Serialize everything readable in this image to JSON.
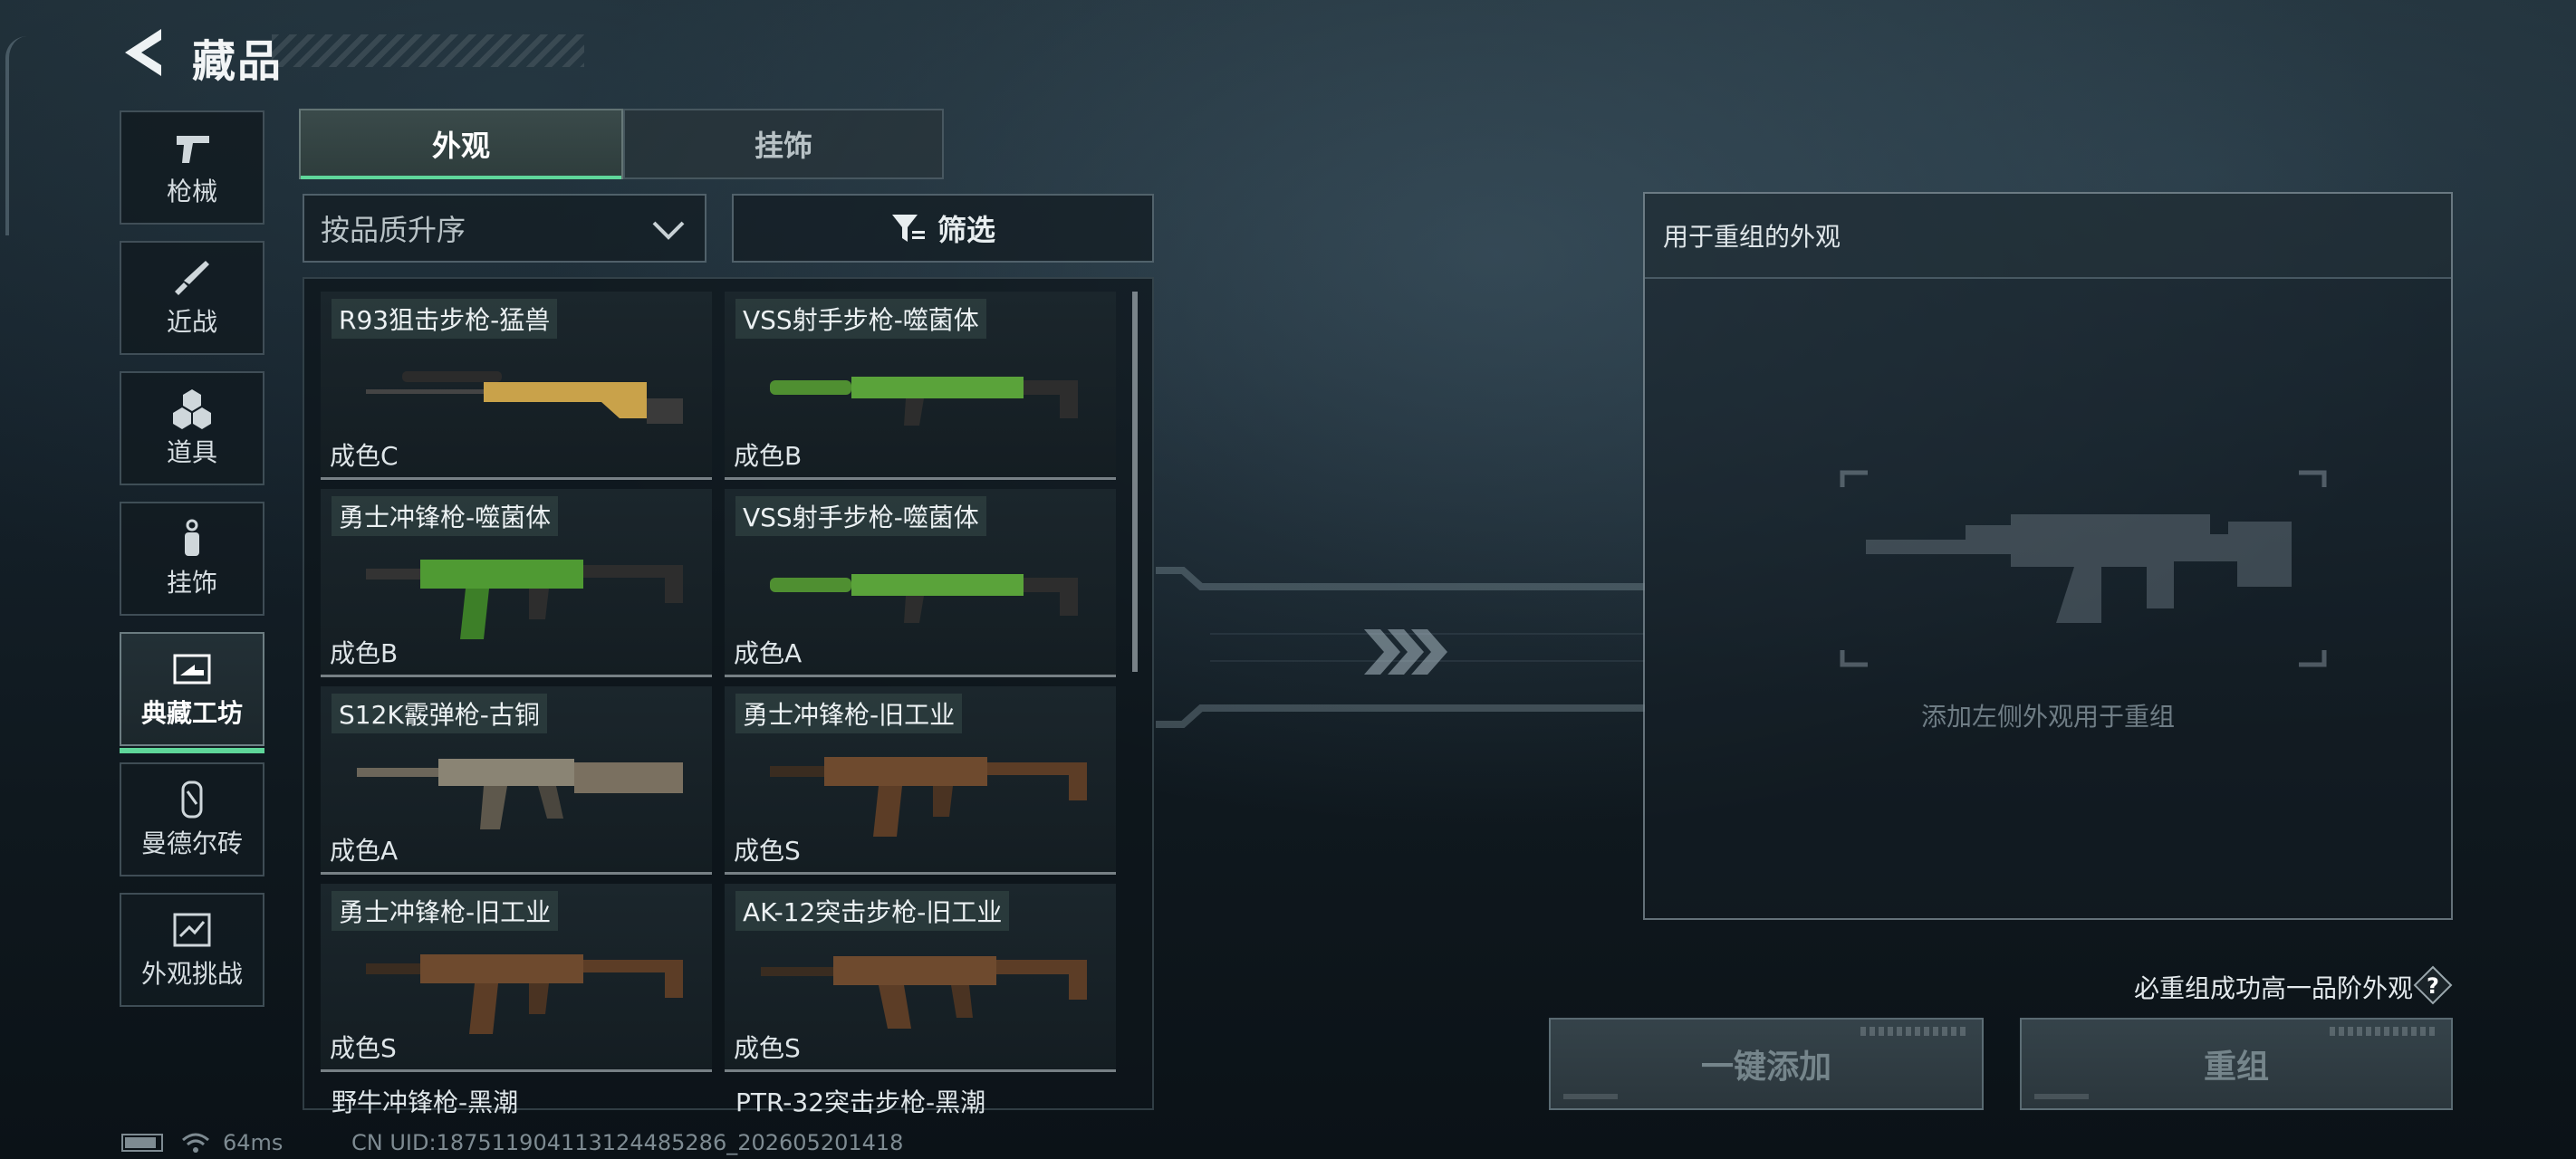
{
  "header": {
    "title": "藏品"
  },
  "categories": [
    {
      "label": "枪械",
      "icon": "pistol-icon"
    },
    {
      "label": "近战",
      "icon": "knife-icon"
    },
    {
      "label": "道具",
      "icon": "grenade-icon"
    },
    {
      "label": "挂饰",
      "icon": "charm-icon"
    },
    {
      "label": "典藏工坊",
      "icon": "workshop-icon",
      "active": true
    },
    {
      "label": "曼德尔砖",
      "icon": "brick-icon"
    },
    {
      "label": "外观挑战",
      "icon": "challenge-icon"
    }
  ],
  "tabs": [
    {
      "label": "外观",
      "active": true
    },
    {
      "label": "挂饰",
      "active": false
    }
  ],
  "sort": {
    "label": "按品质升序"
  },
  "filter": {
    "label": "筛选"
  },
  "items": [
    {
      "name": "R93狙击步枪-猛兽",
      "grade": "成色C",
      "color": "#c9a24a"
    },
    {
      "name": "VSS射手步枪-噬菌体",
      "grade": "成色B",
      "color": "#5aa33a"
    },
    {
      "name": "勇士冲锋枪-噬菌体",
      "grade": "成色B",
      "color": "#4f9a33"
    },
    {
      "name": "VSS射手步枪-噬菌体",
      "grade": "成色A",
      "color": "#5aa33a"
    },
    {
      "name": "S12K霰弹枪-古铜",
      "grade": "成色A",
      "color": "#7a7060"
    },
    {
      "name": "勇士冲锋枪-旧工业",
      "grade": "成色S",
      "color": "#6e4a2e"
    },
    {
      "name": "勇士冲锋枪-旧工业",
      "grade": "成色S",
      "color": "#6e4a2e"
    },
    {
      "name": "AK-12突击步枪-旧工业",
      "grade": "成色S",
      "color": "#6e4a2e"
    }
  ],
  "partial_items": [
    "野牛冲锋枪-黑潮",
    "PTR-32突击步枪-黑潮"
  ],
  "panel": {
    "title": "用于重组的外观",
    "hint": "添加左侧外观用于重组"
  },
  "guarantee_text": "必重组成功高一品阶外观",
  "buttons": {
    "add_all": "一键添加",
    "recombine": "重组"
  },
  "status": {
    "ping": "64ms",
    "uid": "CN UID:18751190411312448528​6_202605201418"
  },
  "colors": {
    "accent": "#5fd69a"
  }
}
